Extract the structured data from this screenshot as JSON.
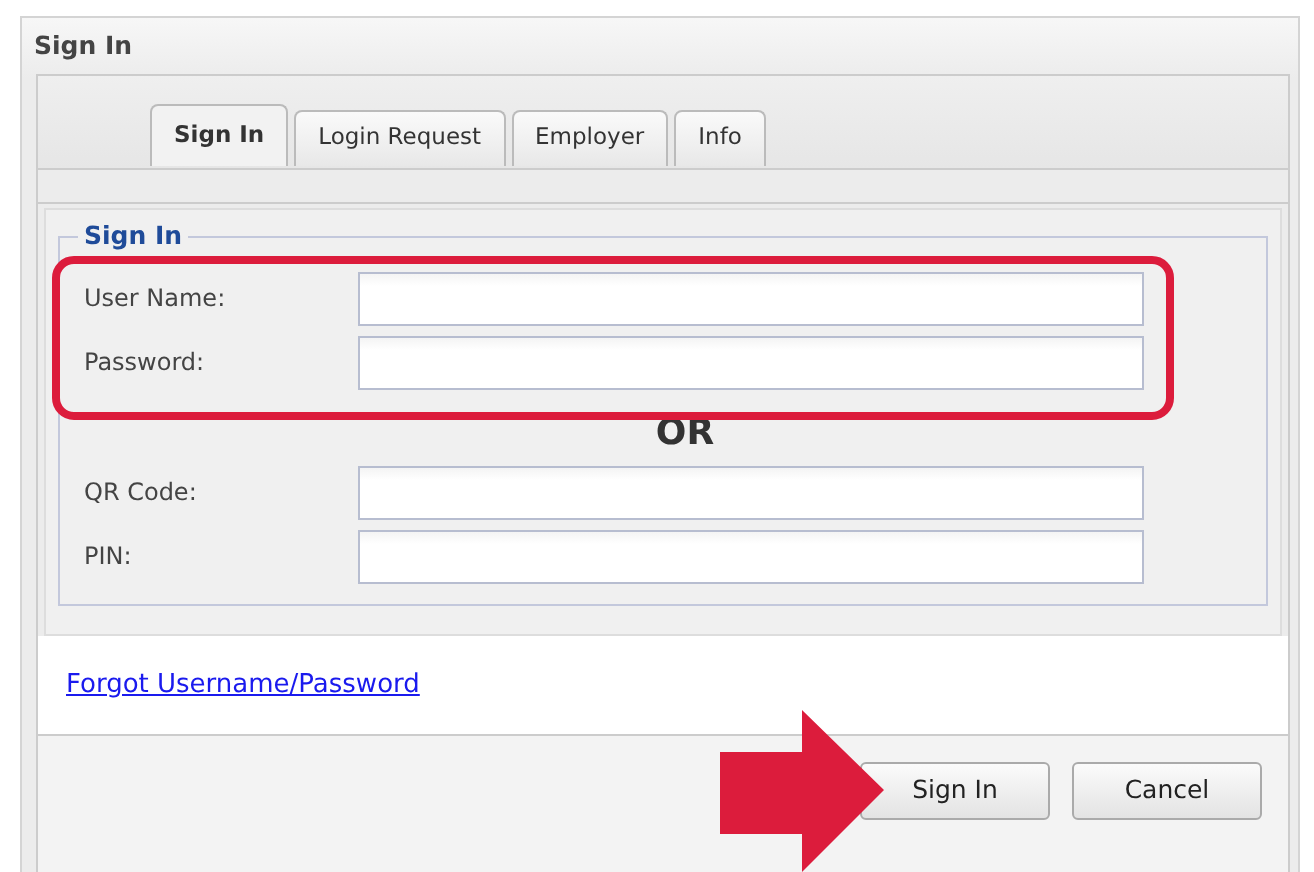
{
  "window": {
    "title": "Sign In"
  },
  "tabs": [
    {
      "label": "Sign In",
      "selected": true
    },
    {
      "label": "Login Request",
      "selected": false
    },
    {
      "label": "Employer",
      "selected": false
    },
    {
      "label": "Info",
      "selected": false
    }
  ],
  "fieldset": {
    "legend": "Sign In",
    "credential_fields": [
      {
        "label": "User Name:"
      },
      {
        "label": "Password:"
      }
    ],
    "separator": "OR",
    "alternate_fields": [
      {
        "label": "QR Code:"
      },
      {
        "label": "PIN:"
      }
    ]
  },
  "link": "Forgot Username/Password",
  "buttons": [
    {
      "label": "Sign In"
    },
    {
      "label": "Cancel"
    }
  ]
}
